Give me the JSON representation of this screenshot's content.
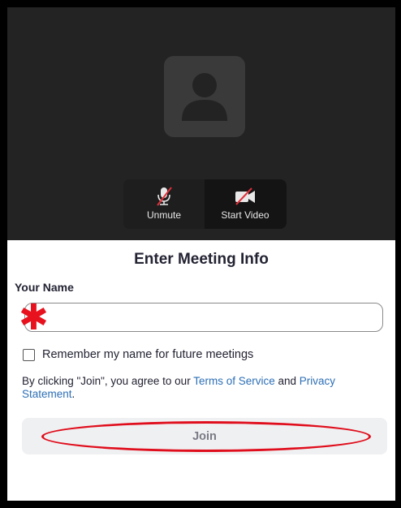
{
  "preview": {
    "avatar_icon": "person-icon",
    "unmute_label": "Unmute",
    "start_video_label": "Start Video",
    "mic_icon": "mic-muted-icon",
    "video_icon": "video-off-icon"
  },
  "form": {
    "title": "Enter Meeting Info",
    "name_label": "Your Name",
    "name_value": "",
    "required_marker": "✱",
    "remember_label": "Remember my name for future meetings",
    "remember_checked": false,
    "terms_prefix": "By clicking \"Join\", you agree to our ",
    "terms_link": "Terms of Service",
    "terms_mid": " and ",
    "privacy_link": "Privacy Statement",
    "terms_suffix": ".",
    "join_label": "Join"
  },
  "colors": {
    "background_dark": "#232323",
    "link": "#2d6fb6",
    "annotation_red": "#e00e1c",
    "join_bg": "#eff0f2"
  }
}
